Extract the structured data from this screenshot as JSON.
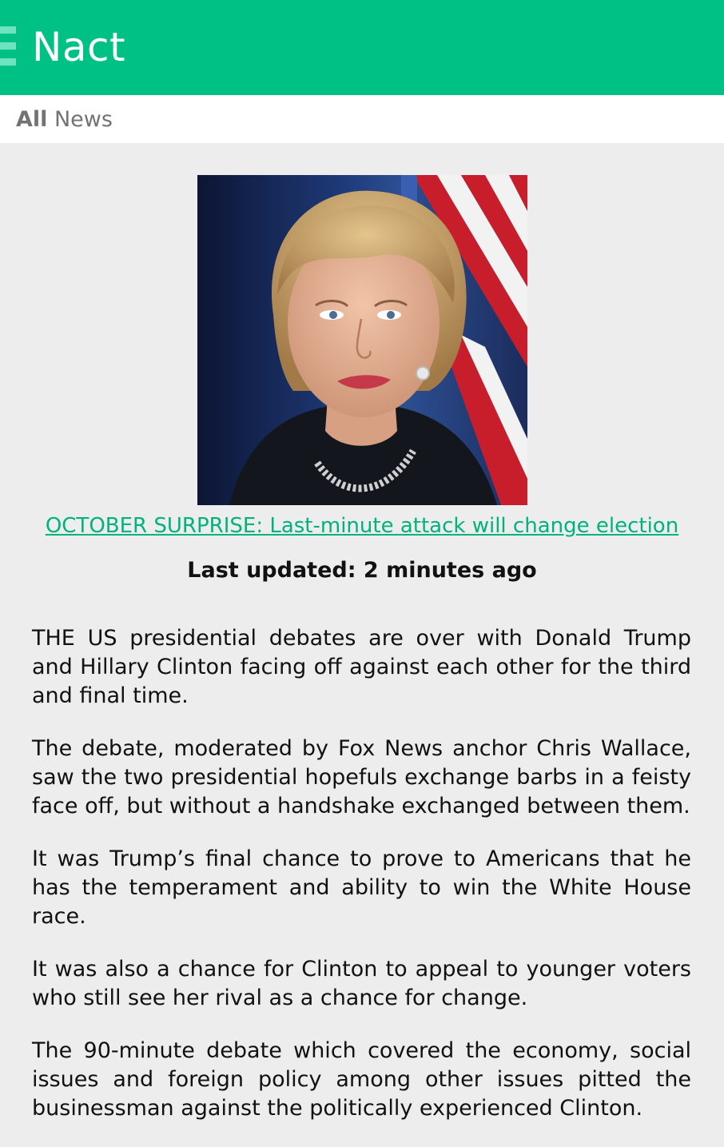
{
  "header": {
    "app_title": "Nact",
    "menu_icon": "hamburger-menu-icon",
    "background_color": "#00c185"
  },
  "subheader": {
    "label_bold": "All",
    "label_rest": " News"
  },
  "article": {
    "image": {
      "subject": "portrait of a woman in front of US flag"
    },
    "headline": "OCTOBER SURPRISE: Last-minute attack will change election",
    "last_updated": "Last updated: 2 minutes ago",
    "paragraphs": [
      "THE US presidential debates are over with Donald Trump and Hillary Clinton facing off against each other for the third and final time.",
      "The debate, moderated by Fox News anchor Chris Wallace, saw the two presidential hopefuls exchange barbs in a feisty face off, but without a handshake exchanged between them.",
      "It was Trump’s final chance to prove to Americans that he has the temperament and ability to win the White House race.",
      "It was also a chance for Clinton to appeal to younger voters who still see her rival as a chance for change.",
      "The 90-minute debate which covered the economy, social issues and foreign policy among other issues pitted the businessman against the politically experienced Clinton."
    ]
  },
  "colors": {
    "accent": "#00c185",
    "link": "#00b27b",
    "page_background": "#ededed"
  }
}
